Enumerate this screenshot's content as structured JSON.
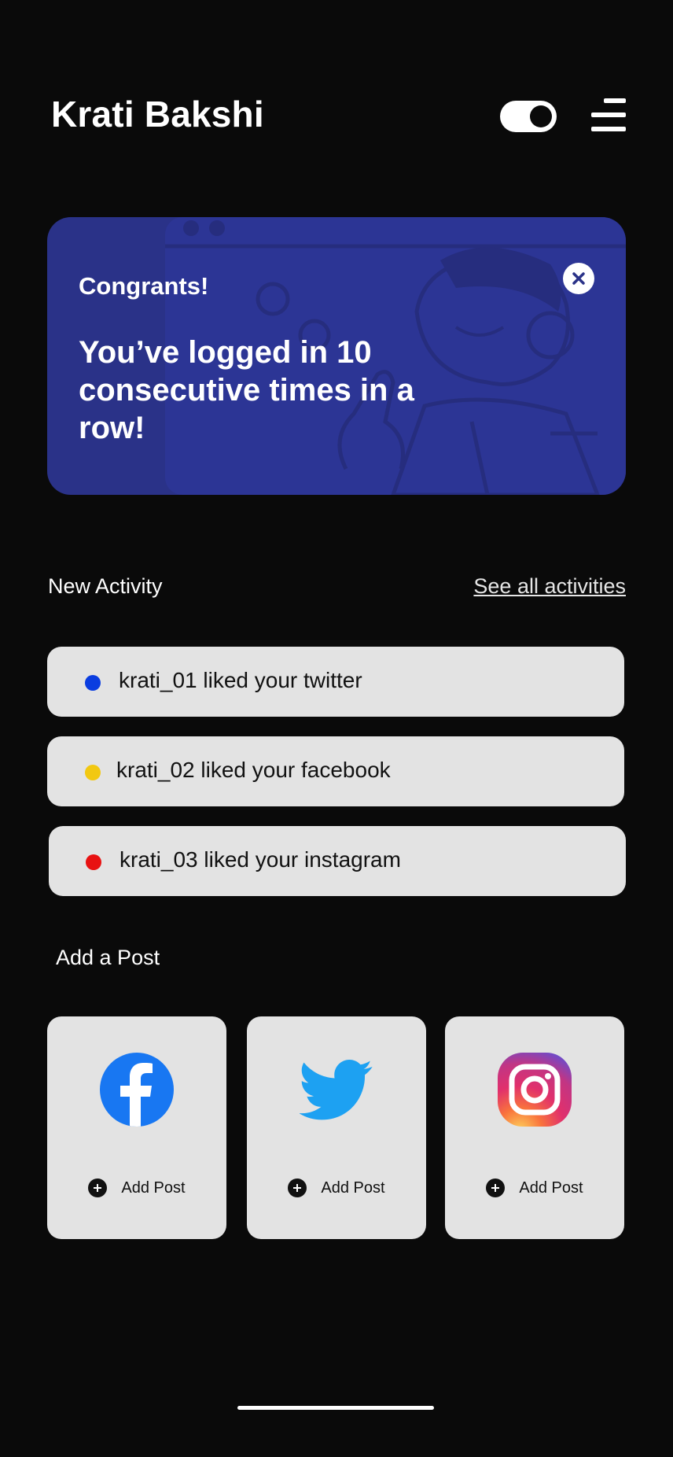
{
  "header": {
    "title": "Krati Bakshi"
  },
  "banner": {
    "heading": "Congrants!",
    "message": "You’ve logged in 10 consecutive times in a row!",
    "background_color": "#2a3288"
  },
  "activity": {
    "section_title": "New Activity",
    "see_all_label": "See all activities",
    "items": [
      {
        "text": "krati_01 liked your twitter",
        "dot_color": "#0a3de0"
      },
      {
        "text": "krati_02 liked your facebook",
        "dot_color": "#f2c811"
      },
      {
        "text": "krati_03 liked your instagram",
        "dot_color": "#e81212"
      }
    ]
  },
  "posts": {
    "section_title": "Add a Post",
    "cards": [
      {
        "icon": "facebook-icon",
        "label": "Add Post"
      },
      {
        "icon": "twitter-icon",
        "label": "Add Post"
      },
      {
        "icon": "instagram-icon",
        "label": "Add Post"
      }
    ]
  }
}
